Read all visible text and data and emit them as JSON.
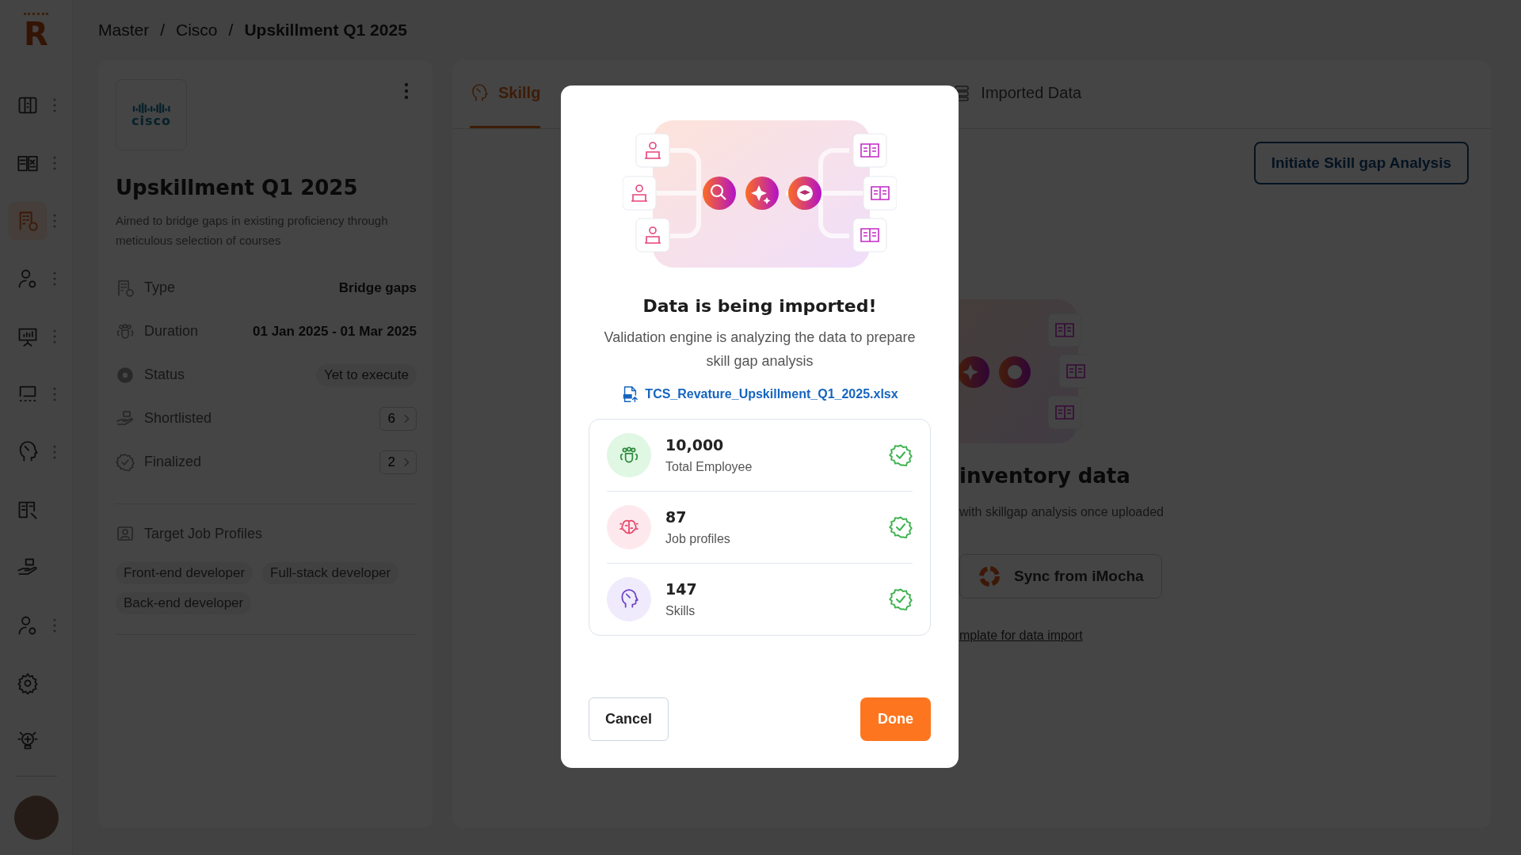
{
  "logo": {
    "letter": "R"
  },
  "sidebar": {
    "items": [
      {
        "kind": "board",
        "menu": true,
        "selected": false
      },
      {
        "kind": "checklist",
        "menu": true,
        "selected": false
      },
      {
        "kind": "building",
        "menu": true,
        "selected": true
      },
      {
        "kind": "user-gear",
        "menu": true,
        "selected": false
      },
      {
        "kind": "presentation",
        "menu": true,
        "selected": false
      },
      {
        "kind": "roadmap",
        "menu": true,
        "selected": false
      },
      {
        "kind": "head",
        "menu": true,
        "selected": false
      },
      {
        "kind": "book",
        "menu": false,
        "selected": false
      },
      {
        "kind": "hand",
        "menu": false,
        "selected": false
      },
      {
        "kind": "user-gear",
        "menu": true,
        "selected": false
      },
      {
        "kind": "gear",
        "menu": false,
        "selected": false
      },
      {
        "kind": "bulb",
        "menu": false,
        "selected": false
      }
    ]
  },
  "breadcrumb": {
    "separator": "/",
    "items": [
      "Master",
      "Cisco",
      "Upskillment Q1 2025"
    ]
  },
  "program": {
    "company_logo": "cisco",
    "title": "Upskillment Q1 2025",
    "description": "Aimed to bridge gaps in existing proficiency through meticulous selection of courses",
    "details": [
      {
        "kind": "text",
        "label": "Type",
        "value": "Bridge gaps"
      },
      {
        "kind": "text",
        "label": "Duration",
        "value": "01 Jan 2025 - 01 Mar 2025"
      },
      {
        "kind": "badge",
        "label": "Status",
        "value": "Yet to execute"
      },
      {
        "kind": "count",
        "label": "Shortlisted",
        "value": "6"
      },
      {
        "kind": "count",
        "label": "Finalized",
        "value": "2"
      }
    ],
    "target_profiles": {
      "title": "Target Job Profiles",
      "tags": [
        "Front-end developer",
        "Full-stack developer",
        "Back-end developer"
      ]
    }
  },
  "tabs": [
    {
      "label": "Skillg",
      "selected": true
    },
    {
      "label": "Imported Data",
      "selected": false
    }
  ],
  "primary_button": "Initiate Skill gap Analysis",
  "empty_state": {
    "title": "inventory data",
    "subtitle": "with skillgap analysis once uploaded",
    "sync_button": "Sync from iMocha",
    "link": "mplate for data import"
  },
  "modal": {
    "title": "Data is being imported!",
    "description": "Validation engine is analyzing the data to prepare skill gap analysis",
    "file": "TCS_Revature_Upskillment_Q1_2025.xlsx",
    "stats": [
      {
        "kind": "people",
        "value": "10,000",
        "label": "Total Employee",
        "color": "#dff7e3",
        "verified": true
      },
      {
        "kind": "brain",
        "value": "87",
        "label": "Job profiles",
        "color": "#fde9ed",
        "verified": true
      },
      {
        "kind": "head",
        "value": "147",
        "label": "Skills",
        "color": "#efebfc",
        "verified": true
      }
    ],
    "cancel": "Cancel",
    "done": "Done"
  }
}
